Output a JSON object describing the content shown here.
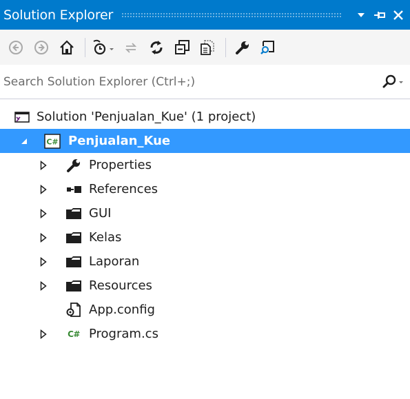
{
  "window": {
    "title": "Solution Explorer",
    "controls": {
      "dropdown": "▾",
      "pin": "pin-icon",
      "close": "✕"
    }
  },
  "toolbar": {
    "buttons": [
      {
        "name": "back",
        "icon": "back-arrow-icon"
      },
      {
        "name": "forward",
        "icon": "forward-arrow-icon"
      },
      {
        "name": "home",
        "icon": "home-icon"
      },
      {
        "name": "pending-changes-filter",
        "icon": "clock-filter-icon"
      },
      {
        "name": "sync-with-active-document",
        "icon": "sync-icon"
      },
      {
        "name": "refresh",
        "icon": "refresh-icon"
      },
      {
        "name": "collapse-all",
        "icon": "collapse-all-icon"
      },
      {
        "name": "show-all-files",
        "icon": "show-all-files-icon"
      },
      {
        "name": "properties",
        "icon": "wrench-icon"
      },
      {
        "name": "preview-selected-items",
        "icon": "preview-icon"
      }
    ]
  },
  "search": {
    "placeholder": "Search Solution Explorer (Ctrl+;)"
  },
  "tree": {
    "solution": {
      "label": "Solution 'Penjualan_Kue' (1 project)",
      "icon": "solution-icon"
    },
    "project": {
      "label": "Penjualan_Kue",
      "icon": "csharp-project-icon",
      "badge": "C#",
      "expanded": true,
      "selected": true
    },
    "items": [
      {
        "label": "Properties",
        "icon": "wrench-icon",
        "expandable": true
      },
      {
        "label": "References",
        "icon": "references-icon",
        "expandable": true
      },
      {
        "label": "GUI",
        "icon": "folder-icon",
        "expandable": true
      },
      {
        "label": "Kelas",
        "icon": "folder-icon",
        "expandable": true
      },
      {
        "label": "Laporan",
        "icon": "folder-icon",
        "expandable": true
      },
      {
        "label": "Resources",
        "icon": "folder-icon",
        "expandable": true
      },
      {
        "label": "App.config",
        "icon": "config-file-icon",
        "expandable": false
      },
      {
        "label": "Program.cs",
        "icon": "csharp-file-icon",
        "badge": "C#",
        "expandable": true
      }
    ]
  },
  "colors": {
    "accent": "#007acc",
    "selection": "#3399ff",
    "toolbar_bg": "#f5f5f5",
    "csharp_green": "#388a34"
  }
}
